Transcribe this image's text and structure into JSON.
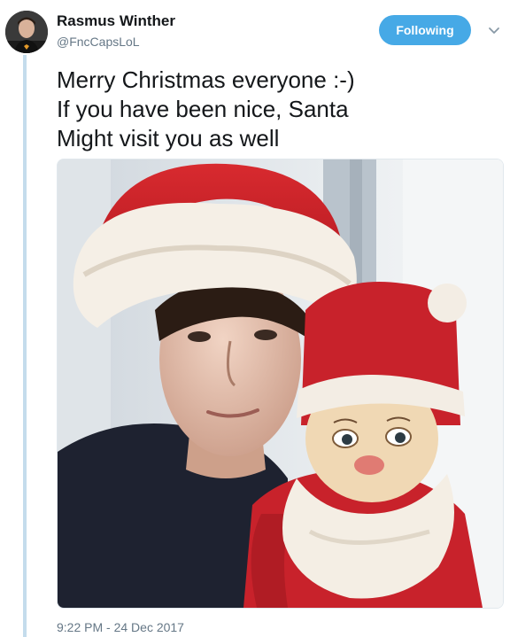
{
  "user": {
    "display_name": "Rasmus Winther",
    "handle": "@FncCapsLoL"
  },
  "follow_button": {
    "label": "Following"
  },
  "tweet": {
    "lines": [
      "Merry Christmas everyone :-)",
      "If you have been nice, Santa",
      "Might visit you as well"
    ],
    "timestamp": "9:22 PM - 24 Dec 2017"
  },
  "icons": {
    "menu": "chevron-down-icon"
  },
  "colors": {
    "follow_button": "#46a9e6",
    "thread_line": "#c4dcec",
    "muted_text": "#657786"
  }
}
